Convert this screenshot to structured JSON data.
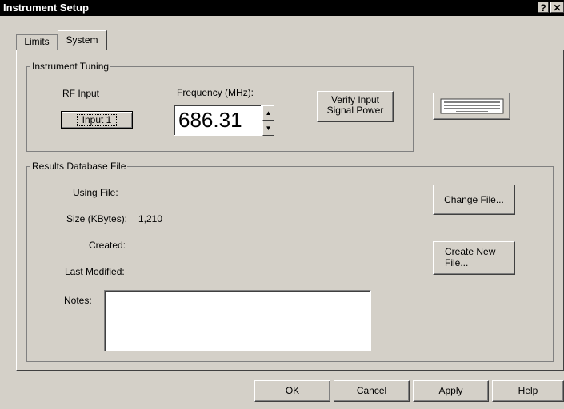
{
  "window": {
    "title": "Instrument Setup",
    "help_glyph": "?",
    "close_glyph": "✕"
  },
  "tabs": [
    {
      "label": "Limits"
    },
    {
      "label": "System"
    }
  ],
  "tuning": {
    "legend": "Instrument Tuning",
    "rf_input_label": "RF Input",
    "rf_input_button": "Input 1",
    "frequency_label": "Frequency (MHz):",
    "frequency_value": "686.31",
    "verify_button_line1": "Verify Input",
    "verify_button_line2": "Signal Power"
  },
  "results": {
    "legend": "Results Database File",
    "using_file_label": "Using File:",
    "size_label": "Size (KBytes):",
    "size_value": "1,210",
    "created_label": "Created:",
    "last_modified_label": "Last Modified:",
    "notes_label": "Notes:",
    "notes_value": "",
    "change_file_button": "Change File...",
    "create_new_line1": "Create New",
    "create_new_line2": "File..."
  },
  "footer": {
    "ok": "OK",
    "cancel": "Cancel",
    "apply": "Apply",
    "help": "Help"
  }
}
